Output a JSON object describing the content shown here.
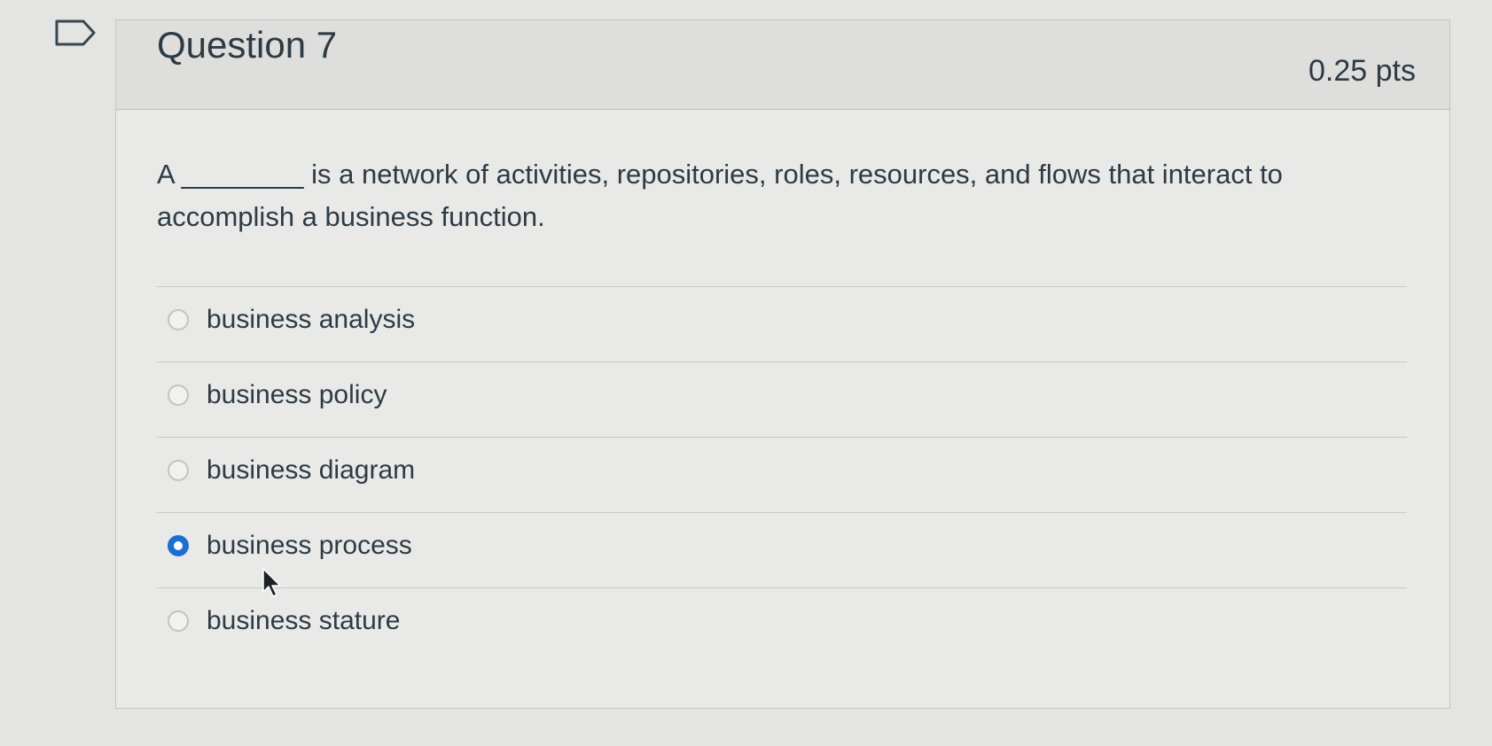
{
  "question": {
    "title": "Question 7",
    "points": "0.25 pts",
    "text": "A ________ is a network of activities, repositories, roles, resources, and flows that interact to accomplish a business function."
  },
  "answers": [
    {
      "label": "business analysis",
      "selected": false
    },
    {
      "label": "business policy",
      "selected": false
    },
    {
      "label": "business diagram",
      "selected": false
    },
    {
      "label": "business process",
      "selected": true
    },
    {
      "label": "business stature",
      "selected": false
    }
  ],
  "colors": {
    "accent": "#1b6fd0",
    "text": "#2d3b45"
  },
  "icons": {
    "flag": "flag-icon",
    "cursor": "mouse-pointer-icon"
  }
}
